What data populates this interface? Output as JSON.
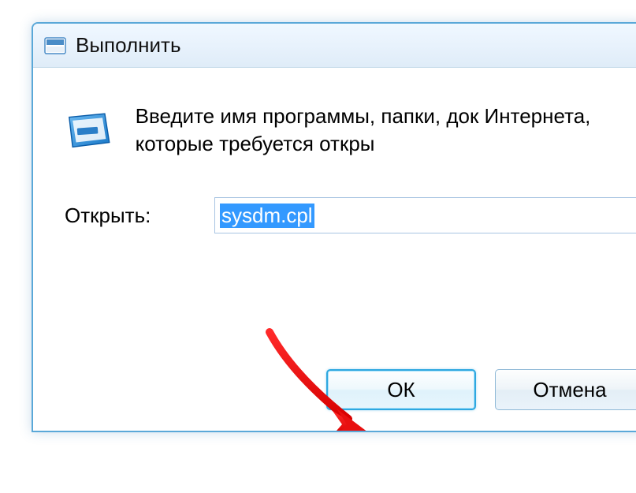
{
  "dialog": {
    "title": "Выполнить",
    "description": "Введите имя программы, папки, док Интернета, которые требуется откры",
    "open_label": "Открыть:",
    "input_value": "sysdm.cpl",
    "buttons": {
      "ok": "ОК",
      "cancel": "Отмена"
    }
  }
}
